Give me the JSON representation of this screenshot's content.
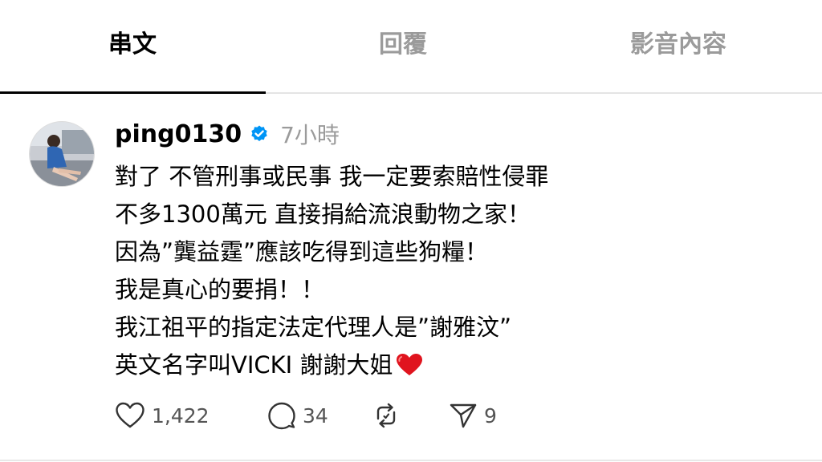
{
  "tabs": [
    {
      "label": "串文",
      "active": true
    },
    {
      "label": "回覆",
      "active": false
    },
    {
      "label": "影音內容",
      "active": false
    }
  ],
  "post": {
    "username": "ping0130",
    "verified": true,
    "timestamp": "7小時",
    "lines": [
      "對了 不管刑事或民事 我一定要索賠性侵罪",
      "不多1300萬元 直接捐給流浪動物之家！",
      "因為”龔益霆”應該吃得到這些狗糧！",
      "我是真心的要捐！！",
      "我江祖平的指定法定代理人是”謝雅汶”",
      "英文名字叫VICKI 謝謝大姐"
    ],
    "emoji": "red-heart",
    "actions": {
      "likes": "1,422",
      "comments": "34",
      "shares": "9"
    }
  },
  "colors": {
    "verified": "#0095f6",
    "muted": "#9b9b9b",
    "heart": "#e0141e"
  }
}
